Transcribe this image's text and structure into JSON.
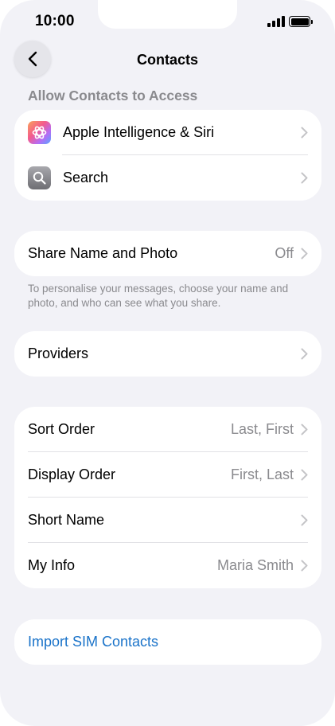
{
  "status_bar": {
    "time": "10:00"
  },
  "nav": {
    "title": "Contacts"
  },
  "access_section": {
    "header": "Allow Contacts to Access",
    "items": [
      {
        "label": "Apple Intelligence & Siri",
        "icon": "apple-intelligence-siri-icon"
      },
      {
        "label": "Search",
        "icon": "search-icon"
      }
    ]
  },
  "share": {
    "label": "Share Name and Photo",
    "value": "Off",
    "footnote": "To personalise your messages, choose your name and photo, and who can see what you share."
  },
  "providers": {
    "label": "Providers"
  },
  "display_section": {
    "items": [
      {
        "label": "Sort Order",
        "value": "Last, First"
      },
      {
        "label": "Display Order",
        "value": "First, Last"
      },
      {
        "label": "Short Name",
        "value": ""
      },
      {
        "label": "My Info",
        "value": "Maria Smith"
      }
    ]
  },
  "import": {
    "label": "Import SIM Contacts"
  },
  "colors": {
    "background": "#f2f2f7",
    "link": "#1a73c9",
    "secondary_text": "#8a8a8e"
  }
}
